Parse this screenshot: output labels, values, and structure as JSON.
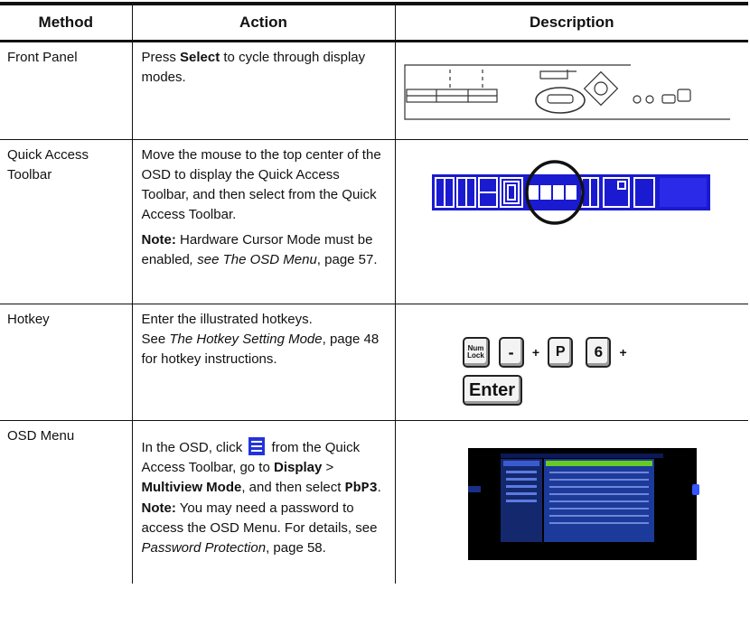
{
  "headers": {
    "method": "Method",
    "action": "Action",
    "description": "Description"
  },
  "rows": [
    {
      "method": "Front Panel",
      "action": {
        "pre": "Press ",
        "bold": "Select",
        "post": " to cycle through display modes."
      }
    },
    {
      "method": "Quick Access Toolbar",
      "action": {
        "text": "Move the mouse to the top center of the OSD to display the Quick Access Toolbar, and then select from the Quick Access Toolbar.",
        "note_label": "Note:",
        "note_pre": " Hardware Cursor Mode must be enabled",
        "note_italic": ", see The OSD Menu",
        "note_post": ", page 57."
      }
    },
    {
      "method": "Hotkey",
      "action": {
        "line1": "Enter the illustrated hotkeys.",
        "see": "See ",
        "italic": "The Hotkey Setting Mode",
        "post": ", page 48 for hotkey instructions."
      },
      "keys": [
        "Num Lock",
        "-",
        "+",
        "P",
        "6",
        "+",
        "Enter"
      ]
    },
    {
      "method": "OSD Menu",
      "action": {
        "pre": "In the OSD, click",
        "mid": " from the Quick Access Toolbar, go to ",
        "display": "Display",
        "gt": " > ",
        "multiview": "Multiview Mode",
        "and": ", and then select ",
        "pbp3": "PbP3",
        "dot": ".",
        "note_label": "Note:",
        "note_text": " You may need a password to access the OSD Menu. For details, see ",
        "note_italic": "Password Protection",
        "note_post": ", page 58."
      }
    }
  ],
  "colors": {
    "toolbar_blue": "#1a1ad0",
    "menu_icon_blue": "#2233dd",
    "osd_green": "#66cc22",
    "osd_panel": "#14286e"
  }
}
